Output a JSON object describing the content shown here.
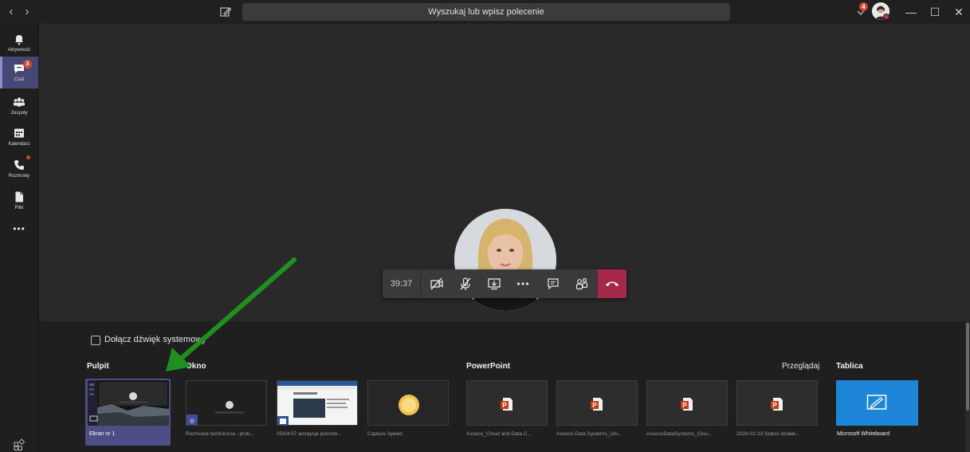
{
  "titlebar": {
    "search_placeholder": "Wyszukaj lub wpisz polecenie",
    "notification_count": "4"
  },
  "rail": {
    "items": [
      {
        "label": "Aktywność",
        "icon": "bell-icon"
      },
      {
        "label": "Czat",
        "icon": "chat-icon",
        "badge": "3",
        "active": true
      },
      {
        "label": "Zespoły",
        "icon": "teams-icon"
      },
      {
        "label": "Kalendarz",
        "icon": "calendar-icon"
      },
      {
        "label": "Rozmowy",
        "icon": "phone-icon",
        "dot": true
      },
      {
        "label": "Pliki",
        "icon": "file-icon"
      }
    ],
    "more": "•••"
  },
  "call": {
    "timer": "39:37",
    "hangup_color": "#a6294a"
  },
  "share": {
    "system_audio_label": "Dołącz dźwięk systemowy",
    "sections": {
      "desktop": "Pulpit",
      "window": "Okno",
      "powerpoint": "PowerPoint",
      "browse": "Przeglądaj",
      "whiteboard": "Tablica"
    },
    "desktop_tile": "Ekran nr 1",
    "windows": [
      "Rozmowa techniczna - prob...",
      "05/04/37 anzaycja potrzeb...",
      "Capture Speed"
    ],
    "powerpoint_files": [
      "Asseco_Cloud and Data C...",
      "Asseco Data Systems_Uni...",
      "AssecoDataSystems_Clou...",
      "2020-02-23 Status działal..."
    ],
    "whiteboard_label": "Microsoft Whiteboard",
    "accent": "#464775",
    "whiteboard_color": "#1e86d6"
  }
}
